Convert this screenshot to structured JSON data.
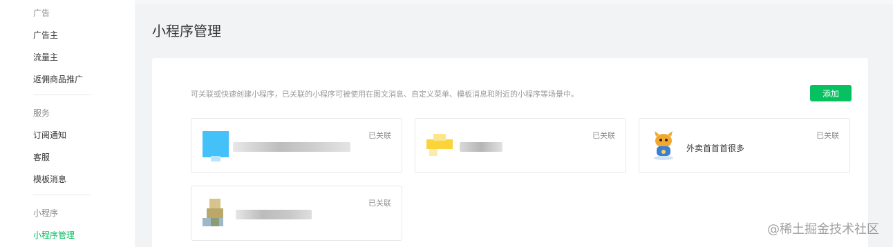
{
  "sidebar": {
    "section_ad": "广告",
    "item_advertiser": "广告主",
    "item_publisher": "流量主",
    "item_rebate": "返佣商品推广",
    "section_service": "服务",
    "item_subscribe": "订阅通知",
    "item_customer_service": "客服",
    "item_template": "模板消息",
    "section_miniprogram": "小程序",
    "item_mp_manage": "小程序管理"
  },
  "main": {
    "title": "小程序管理",
    "description": "可关联或快速创建小程序，已关联的小程序可被使用在图文消息、自定义菜单、模板消息和附近的小程序等场景中。",
    "add_button": "添加",
    "cards": [
      {
        "status": "已关联",
        "name": "",
        "avatar_colors": [
          "#45c1fa",
          "#8ad7fb"
        ]
      },
      {
        "status": "已关联",
        "name": "",
        "avatar_colors": [
          "#fbd33a",
          "#fde68a"
        ]
      },
      {
        "status": "已关联",
        "name": "外卖首首首很多",
        "avatar_colors": [
          "#f0a830",
          "#3a7fd0"
        ]
      },
      {
        "status": "已关联",
        "name": "",
        "avatar_colors": [
          "#b9a86a",
          "#9fb8c8"
        ]
      }
    ]
  },
  "watermark": "@稀土掘金技术社区",
  "colors": {
    "accent": "#07c160",
    "background": "#f2f3f5"
  }
}
